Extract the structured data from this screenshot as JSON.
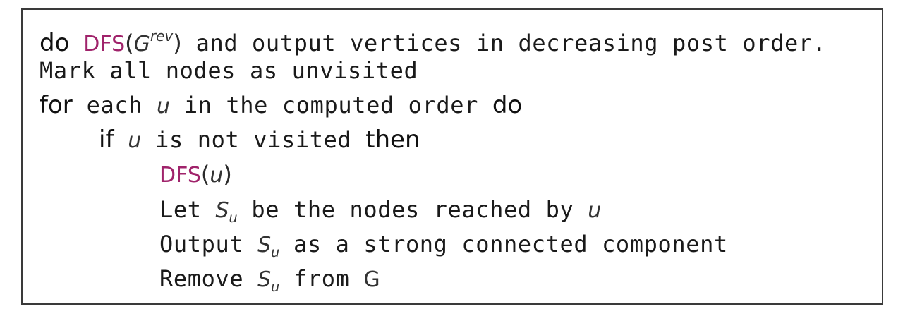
{
  "algorithm": {
    "line1": {
      "kw_do": "do",
      "fn": "DFS",
      "open": "(",
      "graph": "G",
      "graph_sup": "rev",
      "close": ")",
      "text": " and output vertices in decreasing post order."
    },
    "line2": {
      "text": "Mark all nodes as unvisited"
    },
    "line3": {
      "kw_for": "for",
      "text_a": " each ",
      "var": "u",
      "text_b": " in the computed order ",
      "kw_do": "do"
    },
    "line4": {
      "kw_if": "if",
      "text_a": " ",
      "var": "u",
      "text_b": " is not visited ",
      "kw_then": "then"
    },
    "line5": {
      "fn": "DFS",
      "open": "(",
      "var": "u",
      "close": ")"
    },
    "line6": {
      "text_a": "Let ",
      "set": "S",
      "set_sub": "u",
      "text_b": " be the nodes reached by ",
      "var": "u"
    },
    "line7": {
      "text_a": "Output ",
      "set": "S",
      "set_sub": "u",
      "text_b": " as a strong connected component"
    },
    "line8": {
      "text_a": "Remove ",
      "set": "S",
      "set_sub": "u",
      "text_b": " from ",
      "graph": "G"
    }
  },
  "colors": {
    "function_accent": "#a0236b",
    "border": "#3a3a3a",
    "text": "#1a1a1a"
  }
}
